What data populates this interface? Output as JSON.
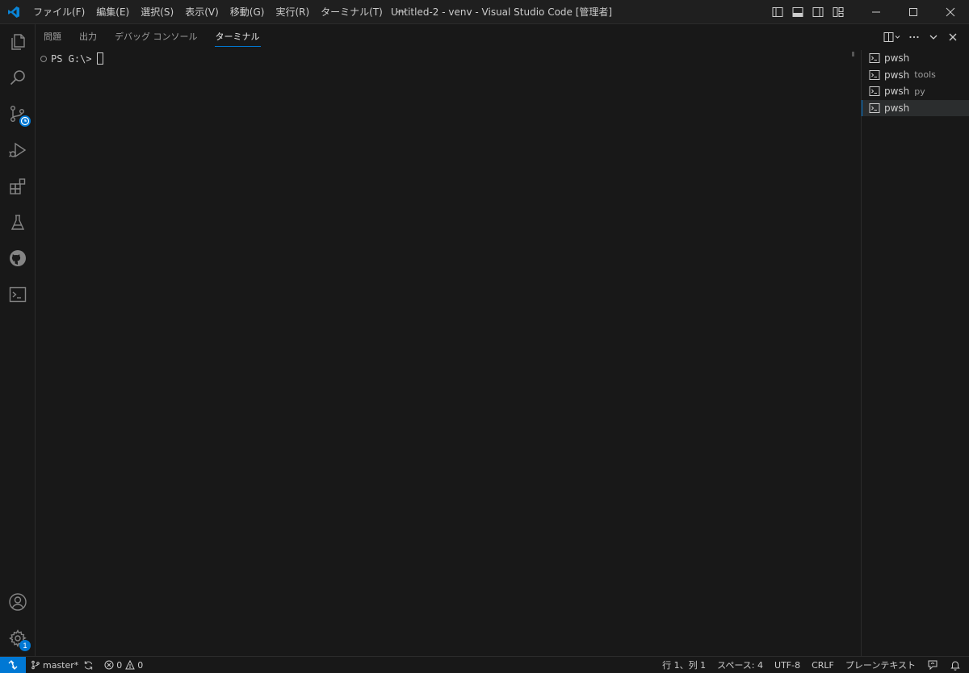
{
  "titlebar": {
    "menus": [
      "ファイル(F)",
      "編集(E)",
      "選択(S)",
      "表示(V)",
      "移動(G)",
      "実行(R)",
      "ターミナル(T)"
    ],
    "more": "···",
    "window_title": "Untitled-2 - venv - Visual Studio Code [管理者]"
  },
  "activitybar": {
    "items": [
      "explorer-icon",
      "search-icon",
      "source-control-icon",
      "run-debug-icon",
      "extensions-icon",
      "testing-icon",
      "github-icon",
      "terminal-icon"
    ],
    "bottom": [
      "account-icon",
      "manage-gear-icon"
    ],
    "settings_badge": "1"
  },
  "panel": {
    "tabs": [
      "問題",
      "出力",
      "デバッグ コンソール",
      "ターミナル"
    ],
    "active_tab": "ターミナル",
    "prompt": "PS G:\\>",
    "terminals": [
      {
        "name": "pwsh",
        "desc": ""
      },
      {
        "name": "pwsh",
        "desc": "tools"
      },
      {
        "name": "pwsh",
        "desc": "py"
      },
      {
        "name": "pwsh",
        "desc": ""
      }
    ]
  },
  "statusbar": {
    "branch": "master*",
    "errors": "0",
    "warnings": "0",
    "position": "行 1、列 1",
    "spaces": "スペース: 4",
    "encoding": "UTF-8",
    "eol": "CRLF",
    "language": "プレーンテキスト"
  },
  "colors": {
    "accent": "#0078d4",
    "background": "#181818",
    "titlebar": "#1f1f1f"
  }
}
